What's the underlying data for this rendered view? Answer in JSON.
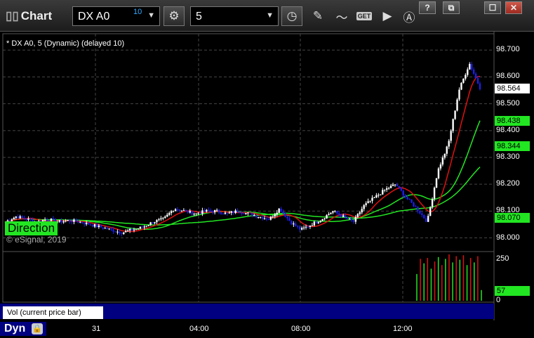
{
  "window": {
    "title": "Chart",
    "symbol": "DX A0",
    "symbol_delay_badge": "10",
    "interval": "5",
    "controls": {
      "help": "?",
      "restore": "⧉",
      "maximize": "☐",
      "close": "✕"
    }
  },
  "toolbar_icons": [
    "gear-icon",
    "clock-icon",
    "pencil-icon",
    "study-icon",
    "get-icon",
    "play-icon",
    "alert-icon"
  ],
  "toolbar": {
    "get_label": "GET"
  },
  "chart_header": "* DX A0, 5 (Dynamic) (delayed 10)",
  "chart_labels": {
    "direction": "Direction",
    "copyright": "© eSignal, 2019"
  },
  "volume_panel": {
    "label": "Vol (current price bar)",
    "close_glyph": "✕",
    "value_tag": "57",
    "axis": [
      "250",
      "0"
    ]
  },
  "price_tags": {
    "last": "98.564",
    "ma1": "98.438",
    "ma2": "98.344",
    "ma3": "98.070"
  },
  "colors": {
    "last": "#ffffff",
    "ma": "#22e622",
    "up": "#ffffff",
    "down": "#1e1ee6",
    "ma_red": "#e01010",
    "ma_green": "#22e622"
  },
  "bottom": {
    "dyn_label": "Dyn",
    "lock_icon": "lock-icon"
  },
  "chart_data": {
    "type": "candlestick",
    "y_ticks": [
      "98.700",
      "98.600",
      "98.500",
      "98.400",
      "98.300",
      "98.200",
      "98.100",
      "98.000"
    ],
    "ylim": [
      97.97,
      98.74
    ],
    "x_ticks": [
      "31",
      "04:00",
      "08:00",
      "12:00"
    ],
    "close_path": [
      98.06,
      98.08,
      98.07,
      98.06,
      98.07,
      98.06,
      98.065,
      98.06,
      98.05,
      98.04,
      98.03,
      98.02,
      98.03,
      98.04,
      98.06,
      98.07,
      98.11,
      98.1,
      98.09,
      98.1,
      98.1,
      98.09,
      98.1,
      98.09,
      98.08,
      98.07,
      98.11,
      98.06,
      98.03,
      98.05,
      98.07,
      98.1,
      98.08,
      98.06,
      98.12,
      98.15,
      98.18,
      98.2,
      98.15,
      98.11,
      98.06,
      98.25,
      98.35,
      98.55,
      98.65,
      98.56
    ],
    "volume_path": [
      150,
      235,
      210,
      240,
      180,
      220,
      245,
      200,
      235,
      260,
      215,
      250,
      230,
      255,
      200,
      240,
      215,
      250,
      60
    ]
  }
}
